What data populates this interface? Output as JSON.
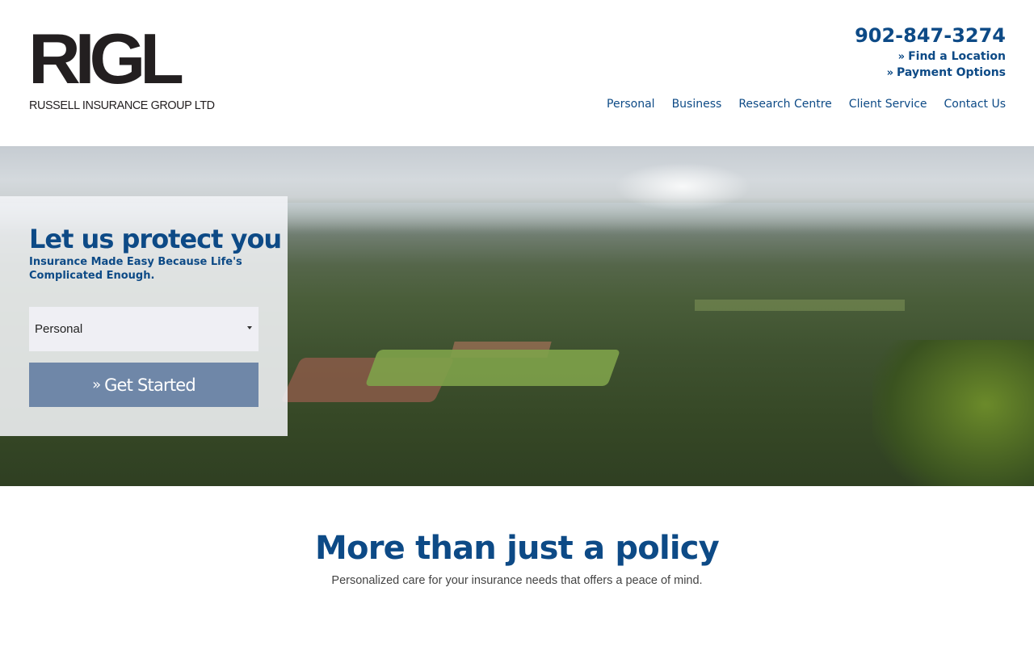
{
  "brand": {
    "logo_mark": "RIGL",
    "logo_sub": "RUSSELL INSURANCE GROUP LTD",
    "primary_color": "#0d4a86"
  },
  "header": {
    "phone": "902-847-3274",
    "links": [
      {
        "label": "Find a Location",
        "icon": "double-chevron-right-icon"
      },
      {
        "label": "Payment Options",
        "icon": "double-chevron-right-icon"
      }
    ],
    "nav": [
      "Personal",
      "Business",
      "Research Centre",
      "Client Service",
      "Contact Us"
    ]
  },
  "hero": {
    "title": "Let us protect you",
    "subtitle": "Insurance Made Easy Because Life's Complicated Enough.",
    "select": {
      "value": "Personal"
    },
    "button": {
      "label": "Get Started",
      "icon": "double-chevron-right-icon",
      "color": "#6f87a8"
    }
  },
  "intro": {
    "title": "More than just a policy",
    "subtitle": "Personalized care for your insurance needs that offers a peace of mind."
  }
}
